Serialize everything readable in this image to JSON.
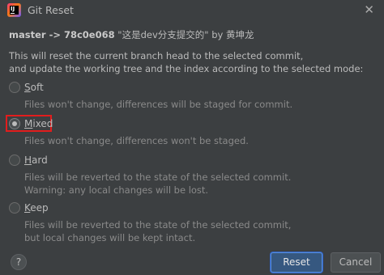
{
  "window": {
    "title": "Git Reset",
    "close_glyph": "✕"
  },
  "header": {
    "branch": "master",
    "arrow": " -> ",
    "commit": "78c0e068",
    "message": " \"这是dev分支提交的\"",
    "by": " by ",
    "author": "黄坤龙"
  },
  "description": {
    "line1": "This will reset the current branch head to the selected commit,",
    "line2": "and update the working tree and the index according to the selected mode:"
  },
  "options": [
    {
      "label_first": "S",
      "label_rest": "oft",
      "hint1": "Files won't change, differences will be staged for commit.",
      "hint2": "",
      "selected": false
    },
    {
      "label_first": "M",
      "label_rest": "ixed",
      "hint1": "Files won't change, differences won't be staged.",
      "hint2": "",
      "selected": true
    },
    {
      "label_first": "H",
      "label_rest": "ard",
      "hint1": "Files will be reverted to the state of the selected commit.",
      "hint2": "Warning: any local changes will be lost.",
      "selected": false
    },
    {
      "label_first": "K",
      "label_rest": "eep",
      "hint1": "Files will be reverted to the state of the selected commit,",
      "hint2": "but local changes will be kept intact.",
      "selected": false
    }
  ],
  "buttons": {
    "help": "?",
    "reset": "Reset",
    "cancel": "Cancel"
  },
  "colors": {
    "background": "#3c3f41",
    "primary_button": "#365880",
    "highlight": "#e21d1d"
  }
}
